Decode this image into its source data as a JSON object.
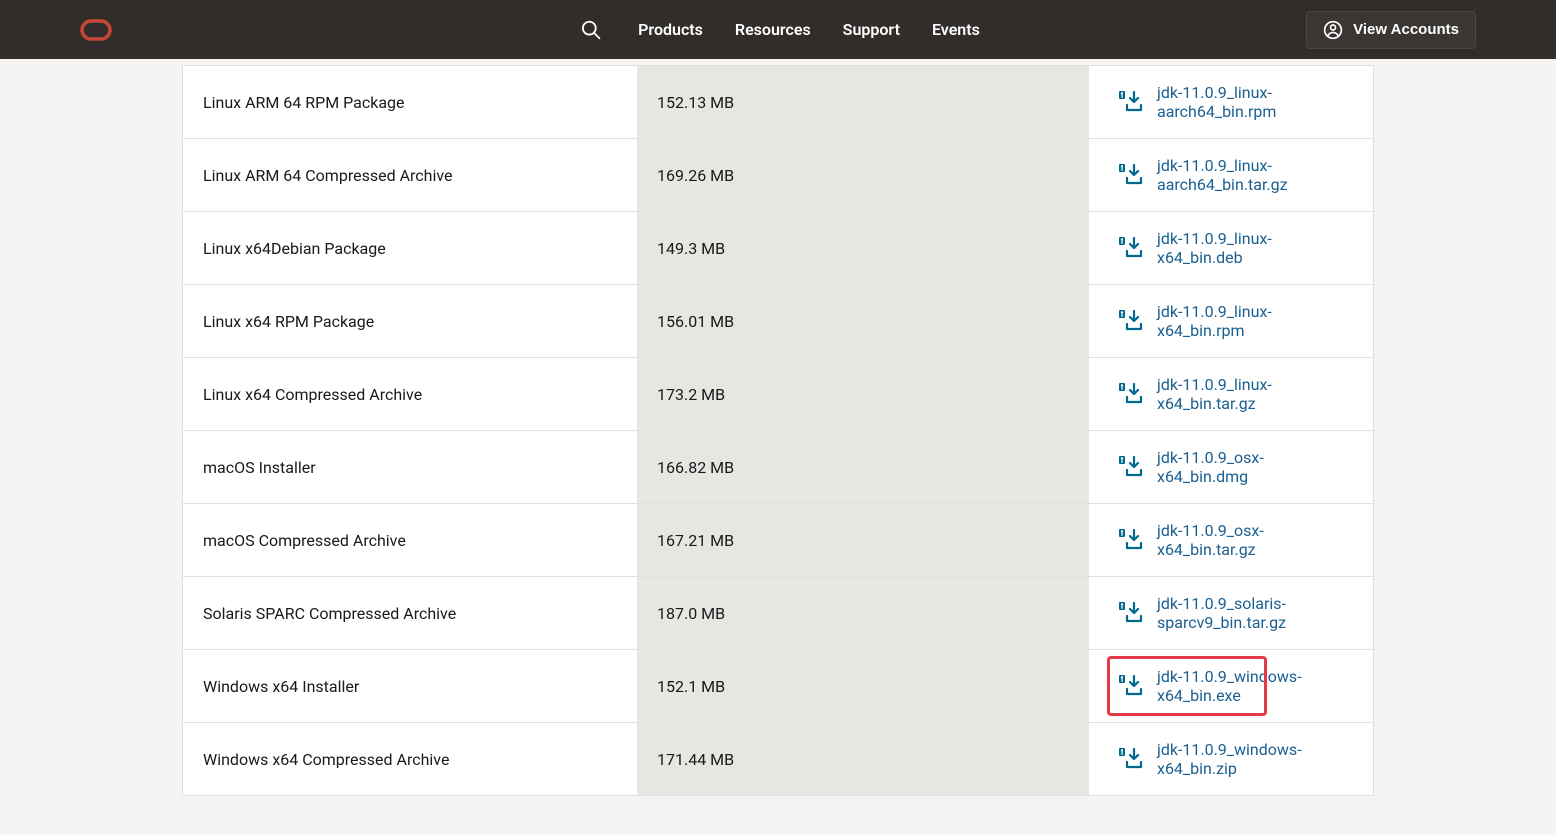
{
  "header": {
    "nav": {
      "products": "Products",
      "resources": "Resources",
      "support": "Support",
      "events": "Events"
    },
    "view_accounts": "View Accounts"
  },
  "downloads": [
    {
      "product": "Linux ARM 64 RPM Package",
      "size": "152.13 MB",
      "filename": "jdk-11.0.9_linux-aarch64_bin.rpm",
      "highlighted": false
    },
    {
      "product": "Linux ARM 64 Compressed Archive",
      "size": "169.26 MB",
      "filename": "jdk-11.0.9_linux-aarch64_bin.tar.gz",
      "highlighted": false
    },
    {
      "product": "Linux x64Debian Package",
      "size": "149.3 MB",
      "filename": "jdk-11.0.9_linux-x64_bin.deb",
      "highlighted": false
    },
    {
      "product": "Linux x64 RPM Package",
      "size": "156.01 MB",
      "filename": "jdk-11.0.9_linux-x64_bin.rpm",
      "highlighted": false
    },
    {
      "product": "Linux x64 Compressed Archive",
      "size": "173.2 MB",
      "filename": "jdk-11.0.9_linux-x64_bin.tar.gz",
      "highlighted": false
    },
    {
      "product": "macOS Installer",
      "size": "166.82 MB",
      "filename": "jdk-11.0.9_osx-x64_bin.dmg",
      "highlighted": false
    },
    {
      "product": "macOS Compressed Archive",
      "size": "167.21 MB",
      "filename": "jdk-11.0.9_osx-x64_bin.tar.gz",
      "highlighted": false
    },
    {
      "product": "Solaris SPARC Compressed Archive",
      "size": "187.0 MB",
      "filename": "jdk-11.0.9_solaris-sparcv9_bin.tar.gz",
      "highlighted": false
    },
    {
      "product": "Windows x64 Installer",
      "size": "152.1 MB",
      "filename": "jdk-11.0.9_windows-x64_bin.exe",
      "highlighted": true
    },
    {
      "product": "Windows x64 Compressed Archive",
      "size": "171.44 MB",
      "filename": "jdk-11.0.9_windows-x64_bin.zip",
      "highlighted": false
    }
  ]
}
